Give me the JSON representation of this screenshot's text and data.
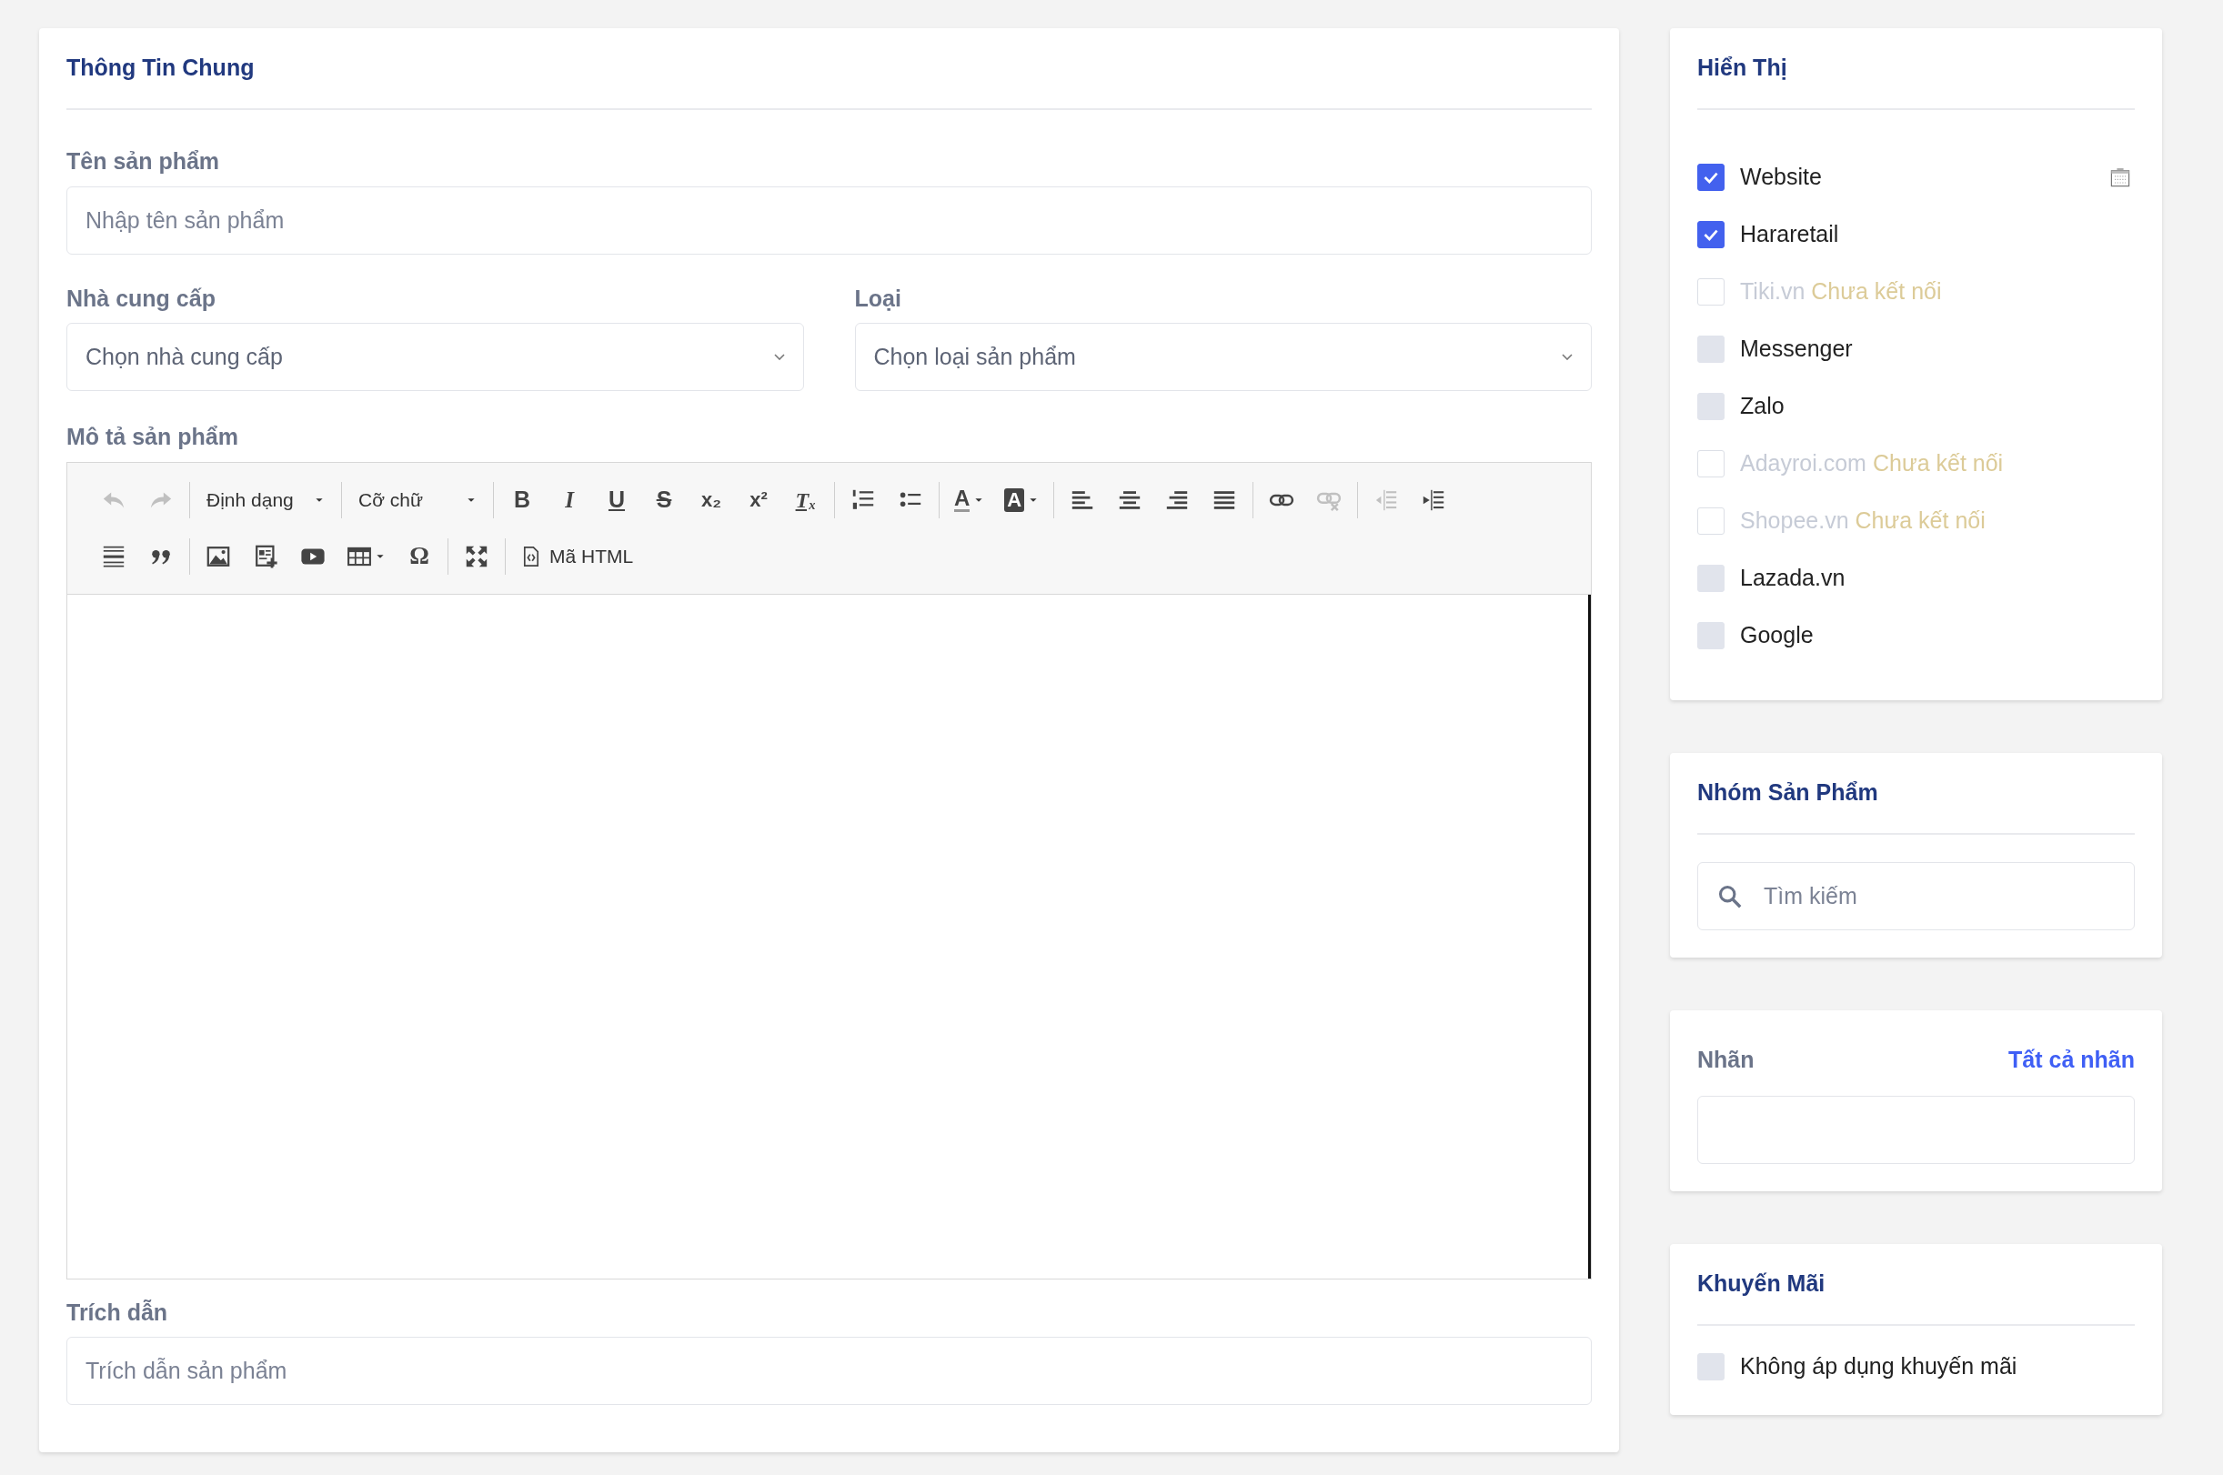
{
  "general": {
    "title": "Thông Tin Chung",
    "name_field": {
      "label": "Tên sản phẩm",
      "placeholder": "Nhập tên sản phẩm"
    },
    "supplier_field": {
      "label": "Nhà cung cấp",
      "placeholder": "Chọn nhà cung cấp"
    },
    "type_field": {
      "label": "Loại",
      "placeholder": "Chọn loại sản phẩm"
    },
    "description": {
      "label": "Mô tả sản phẩm",
      "toolbar": [
        [
          [
            {
              "kind": "icon",
              "disabled": true
            },
            {
              "kind": "icon",
              "disabled": true
            }
          ],
          [
            {
              "kind": "dropdown",
              "label": "Định dạng"
            }
          ],
          [
            {
              "kind": "dropdown",
              "label": "Cỡ chữ"
            }
          ],
          [
            {
              "kind": "glyph",
              "glyph": "B"
            },
            {
              "kind": "glyph",
              "glyph": "I"
            },
            {
              "kind": "glyph",
              "glyph": "U"
            },
            {
              "kind": "glyph",
              "glyph": "S"
            },
            {
              "kind": "glyph",
              "glyph": "x₂"
            },
            {
              "kind": "glyph",
              "glyph": "x²"
            },
            {
              "kind": "glyph",
              "glyph": "Tₓ"
            }
          ],
          [
            {
              "kind": "icon",
              "disabled": false
            },
            {
              "kind": "icon",
              "disabled": false
            }
          ],
          [
            {
              "kind": "glyph",
              "glyph": "A"
            },
            {
              "kind": "glyph",
              "glyph": "A"
            }
          ],
          [
            {
              "kind": "icon",
              "disabled": false
            },
            {
              "kind": "icon",
              "disabled": false
            },
            {
              "kind": "icon",
              "disabled": false
            },
            {
              "kind": "icon",
              "disabled": false
            }
          ],
          [
            {
              "kind": "icon",
              "disabled": false
            },
            {
              "kind": "icon",
              "disabled": true
            }
          ],
          [
            {
              "kind": "icon",
              "disabled": true
            },
            {
              "kind": "icon",
              "disabled": false
            }
          ]
        ],
        [
          [
            {
              "kind": "icon",
              "disabled": false
            },
            {
              "kind": "icon",
              "disabled": false
            }
          ],
          [
            {
              "kind": "icon",
              "disabled": false
            },
            {
              "kind": "icon",
              "disabled": false
            },
            {
              "kind": "icon",
              "disabled": false
            },
            {
              "kind": "icon",
              "disabled": false
            },
            {
              "kind": "glyph",
              "glyph": "Ω"
            }
          ],
          [
            {
              "kind": "icon",
              "disabled": false
            }
          ],
          [
            {
              "kind": "text",
              "label": "Mã HTML"
            }
          ]
        ]
      ]
    },
    "excerpt_field": {
      "label": "Trích dẫn",
      "placeholder": "Trích dẫn sản phẩm"
    }
  },
  "display": {
    "title": "Hiển Thị",
    "channels": [
      {
        "label": "Website",
        "checked": true,
        "disabled": false,
        "has_calendar": true
      },
      {
        "label": "Hararetail",
        "checked": true,
        "disabled": false,
        "has_calendar": false
      },
      {
        "label": "Tiki.vn",
        "note": "Chưa kết nối",
        "checked": false,
        "disabled": true,
        "has_calendar": false
      },
      {
        "label": "Messenger",
        "checked": false,
        "disabled": false,
        "has_calendar": false
      },
      {
        "label": "Zalo",
        "checked": false,
        "disabled": false,
        "has_calendar": false
      },
      {
        "label": "Adayroi.com",
        "note": "Chưa kết nối",
        "checked": false,
        "disabled": true,
        "has_calendar": false
      },
      {
        "label": "Shopee.vn",
        "note": "Chưa kết nối",
        "checked": false,
        "disabled": true,
        "has_calendar": false
      },
      {
        "label": "Lazada.vn",
        "checked": false,
        "disabled": false,
        "has_calendar": false
      },
      {
        "label": "Google",
        "checked": false,
        "disabled": false,
        "has_calendar": false
      }
    ]
  },
  "product_group": {
    "title": "Nhóm Sản Phẩm",
    "search": {
      "placeholder": "Tìm kiếm"
    }
  },
  "tags": {
    "title": "Nhãn",
    "link": "Tất cả nhãn"
  },
  "promotion": {
    "title": "Khuyến Mãi",
    "option": {
      "label": "Không áp dụng khuyến mãi",
      "checked": false
    }
  }
}
